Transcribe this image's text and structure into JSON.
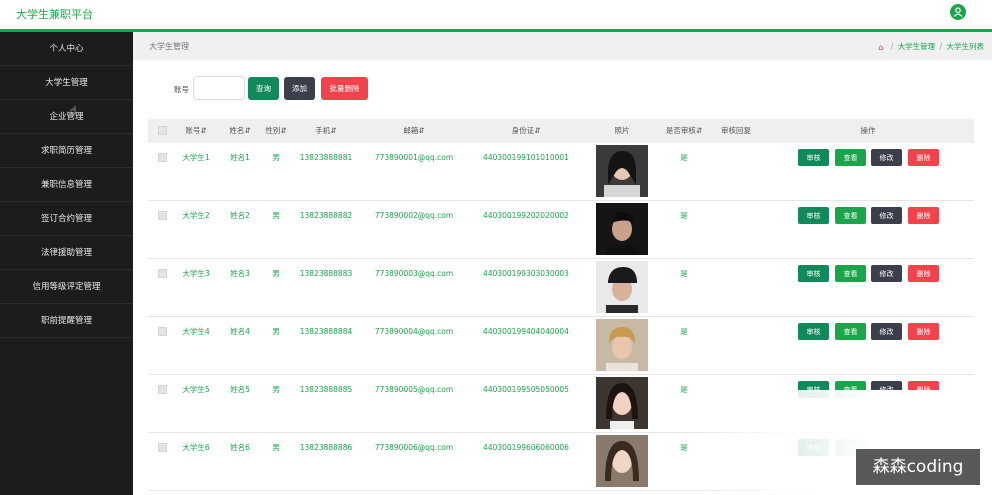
{
  "header": {
    "brand": "大学生兼职平台",
    "user_icon": "user-icon",
    "accent_color": "#1aa54b"
  },
  "sidebar": {
    "items": [
      {
        "label": "个人中心"
      },
      {
        "label": "大学生管理"
      },
      {
        "label": "企业管理"
      },
      {
        "label": "求职简历管理"
      },
      {
        "label": "兼职信息管理"
      },
      {
        "label": "签订合约管理"
      },
      {
        "label": "法律援助管理"
      },
      {
        "label": "信用等级评定管理"
      },
      {
        "label": "职前提醒管理"
      }
    ]
  },
  "breadcrumb": {
    "title": "大学生管理",
    "home_icon": "home-icon",
    "items": [
      "大学生管理",
      "大学生列表"
    ]
  },
  "search": {
    "label": "账号",
    "value": "",
    "query_label": "查询",
    "add_label": "添加",
    "batch_delete_label": "批量删除"
  },
  "table": {
    "headers": [
      "账号",
      "姓名",
      "性别",
      "手机",
      "邮箱",
      "身份证",
      "照片",
      "是否审核",
      "审核回复",
      "操作"
    ],
    "rows": [
      {
        "account": "大学生1",
        "name": "姓名1",
        "gender": "男",
        "phone": "13823888881",
        "email": "773890001@qq.com",
        "id_card": "440300199101010001",
        "approved": "是",
        "reply": ""
      },
      {
        "account": "大学生2",
        "name": "姓名2",
        "gender": "男",
        "phone": "13823888882",
        "email": "773890002@qq.com",
        "id_card": "440300199202020002",
        "approved": "是",
        "reply": ""
      },
      {
        "account": "大学生3",
        "name": "姓名3",
        "gender": "男",
        "phone": "13823888883",
        "email": "773890003@qq.com",
        "id_card": "440300199303030003",
        "approved": "是",
        "reply": ""
      },
      {
        "account": "大学生4",
        "name": "姓名4",
        "gender": "男",
        "phone": "13823888884",
        "email": "773890004@qq.com",
        "id_card": "440300199404040004",
        "approved": "是",
        "reply": ""
      },
      {
        "account": "大学生5",
        "name": "姓名5",
        "gender": "男",
        "phone": "13823888885",
        "email": "773890005@qq.com",
        "id_card": "440300199505050005",
        "approved": "是",
        "reply": ""
      },
      {
        "account": "大学生6",
        "name": "姓名6",
        "gender": "男",
        "phone": "13823888886",
        "email": "773890006@qq.com",
        "id_card": "440300199606060006",
        "approved": "是",
        "reply": ""
      }
    ],
    "actions": {
      "review": "审核",
      "view": "查看",
      "edit": "修改",
      "delete": "删除"
    }
  },
  "watermark": "森森coding"
}
